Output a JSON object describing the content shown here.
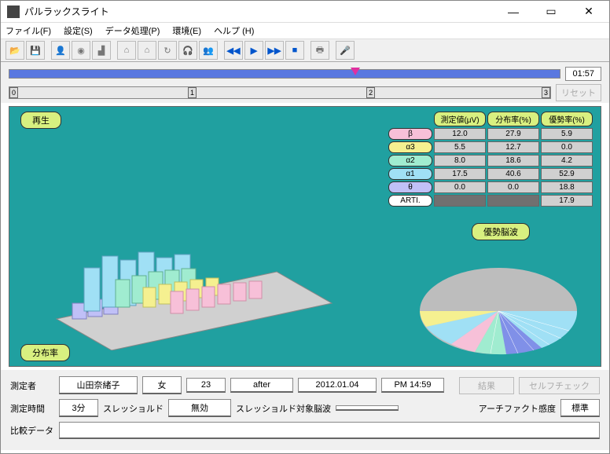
{
  "window": {
    "title": "パルラックスライト"
  },
  "menu": {
    "file": "ファイル(F)",
    "settings": "設定(S)",
    "data": "データ処理(P)",
    "env": "環境(E)",
    "help": "ヘルプ (H)"
  },
  "progress": {
    "time": "01:57",
    "reset": "リセット",
    "ticks": [
      "0",
      "1",
      "2",
      "3"
    ]
  },
  "pills": {
    "replay": "再生",
    "dist": "分布率",
    "dominant": "優勢脳波"
  },
  "table": {
    "headers": {
      "blank": "",
      "measure": "測定値(μV)",
      "dist": "分布率(%)",
      "dom": "優勢率(%)"
    },
    "rows": [
      {
        "label": "β",
        "m": "12.0",
        "d": "27.9",
        "y": "5.9",
        "cls": "beta"
      },
      {
        "label": "α3",
        "m": "5.5",
        "d": "12.7",
        "y": "0.0",
        "cls": "a3"
      },
      {
        "label": "α2",
        "m": "8.0",
        "d": "18.6",
        "y": "4.2",
        "cls": "a2"
      },
      {
        "label": "α1",
        "m": "17.5",
        "d": "40.6",
        "y": "52.9",
        "cls": "a1"
      },
      {
        "label": "θ",
        "m": "0.0",
        "d": "0.0",
        "y": "18.8",
        "cls": "theta"
      },
      {
        "label": "ARTI.",
        "m": "",
        "d": "",
        "y": "17.9",
        "cls": "arti",
        "dark": true
      }
    ]
  },
  "info": {
    "examiner_lbl": "測定者",
    "name": "山田奈緒子",
    "sex": "女",
    "age": "23",
    "phase": "after",
    "date": "2012.01.04",
    "time": "PM 14:59",
    "result_btn": "結果",
    "self_check_btn": "セルフチェック",
    "duration_lbl": "測定時間",
    "duration": "3分",
    "threshold_lbl": "スレッショルド",
    "threshold": "無効",
    "threshold_target_lbl": "スレッショルド対象脳波",
    "threshold_target": "",
    "artifact_lbl": "アーチファクト感度",
    "artifact": "標準",
    "compare_lbl": "比較データ"
  },
  "chart_data": [
    {
      "type": "bar",
      "title": "分布率",
      "note": "3D grouped bars; approximate heights by series across ~15 time bins",
      "series": [
        {
          "name": "θ",
          "color": "#c0c0f7",
          "values": [
            2,
            3,
            1,
            2,
            3,
            2,
            1,
            2,
            1,
            1,
            2,
            1,
            1,
            1,
            1
          ]
        },
        {
          "name": "α1",
          "color": "#a0e0f5",
          "values": [
            12,
            18,
            16,
            20,
            17,
            19,
            22,
            18,
            15,
            14,
            13,
            12,
            11,
            10,
            10
          ]
        },
        {
          "name": "α2",
          "color": "#a0ecd0",
          "values": [
            6,
            7,
            6,
            8,
            7,
            6,
            7,
            6,
            6,
            5,
            5,
            5,
            5,
            4,
            4
          ]
        },
        {
          "name": "α3",
          "color": "#f5f090",
          "values": [
            4,
            5,
            4,
            5,
            5,
            5,
            4,
            4,
            4,
            3,
            3,
            3,
            3,
            3,
            3
          ]
        },
        {
          "name": "β",
          "color": "#f7c0d8",
          "values": [
            8,
            9,
            7,
            8,
            8,
            9,
            8,
            7,
            7,
            6,
            6,
            6,
            6,
            5,
            5
          ]
        }
      ]
    },
    {
      "type": "pie",
      "title": "優勢脳波",
      "slices": [
        {
          "name": "ARTI./無効",
          "value": 42,
          "color": "#bdbdbd"
        },
        {
          "name": "α1",
          "value": 30,
          "color": "#a0e0f5"
        },
        {
          "name": "θ",
          "value": 10,
          "color": "#c0c0f7"
        },
        {
          "name": "α2",
          "value": 6,
          "color": "#a0ecd0"
        },
        {
          "name": "β",
          "value": 7,
          "color": "#f7c0d8"
        },
        {
          "name": "α3",
          "value": 5,
          "color": "#f5f090"
        }
      ]
    }
  ]
}
